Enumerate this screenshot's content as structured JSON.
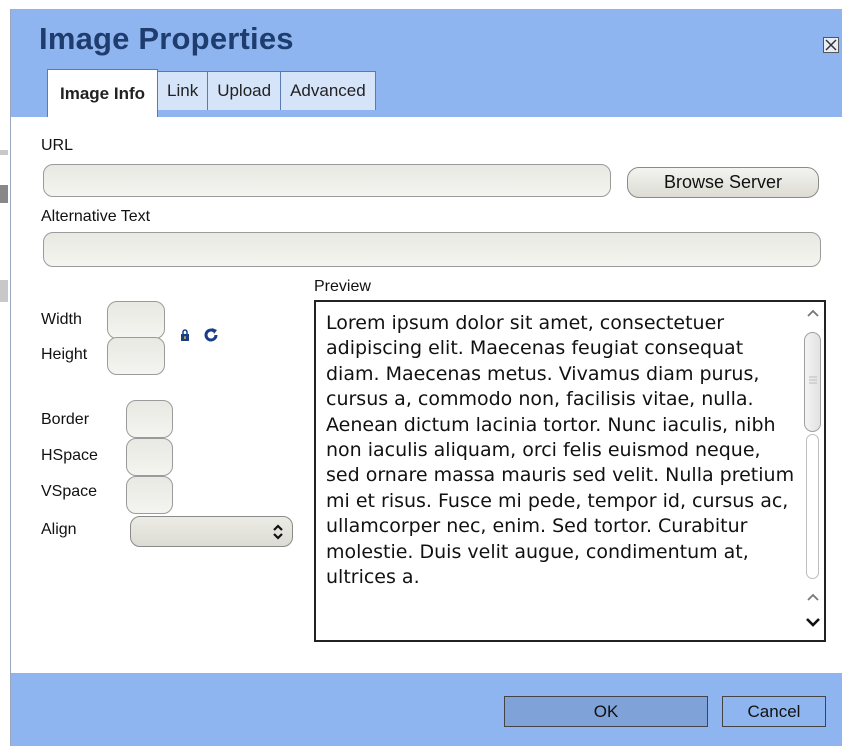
{
  "dialog": {
    "title": "Image Properties",
    "tabs": [
      {
        "label": "Image Info",
        "active": true
      },
      {
        "label": "Link",
        "active": false
      },
      {
        "label": "Upload",
        "active": false
      },
      {
        "label": "Advanced",
        "active": false
      }
    ]
  },
  "form": {
    "url_label": "URL",
    "url_value": "",
    "browse_label": "Browse Server",
    "alt_label": "Alternative Text",
    "alt_value": "",
    "width_label": "Width",
    "height_label": "Height",
    "border_label": "Border",
    "hspace_label": "HSpace",
    "vspace_label": "VSpace",
    "align_label": "Align",
    "align_value": ""
  },
  "preview": {
    "label": "Preview",
    "text": "Lorem ipsum dolor sit amet, consectetuer adipiscing elit. Maecenas feugiat consequat diam. Maecenas metus. Vivamus diam purus, cursus a, commodo non, facilisis vitae, nulla. Aenean dictum lacinia tortor. Nunc iaculis, nibh non iaculis aliquam, orci felis euismod neque, sed ornare massa mauris sed velit. Nulla pretium mi et risus. Fusce mi pede, tempor id, cursus ac, ullamcorper nec, enim. Sed tortor. Curabitur molestie. Duis velit augue, condimentum at, ultrices a."
  },
  "footer": {
    "ok_label": "OK",
    "cancel_label": "Cancel"
  },
  "colors": {
    "accent": "#8fb5f0",
    "title": "#1f3c6e",
    "ok_button": "#7fa2d8"
  },
  "icons": {
    "close": "close-icon",
    "lock": "lock-icon",
    "reset": "reset-size-icon",
    "select_arrows": "select-arrows-icon"
  }
}
